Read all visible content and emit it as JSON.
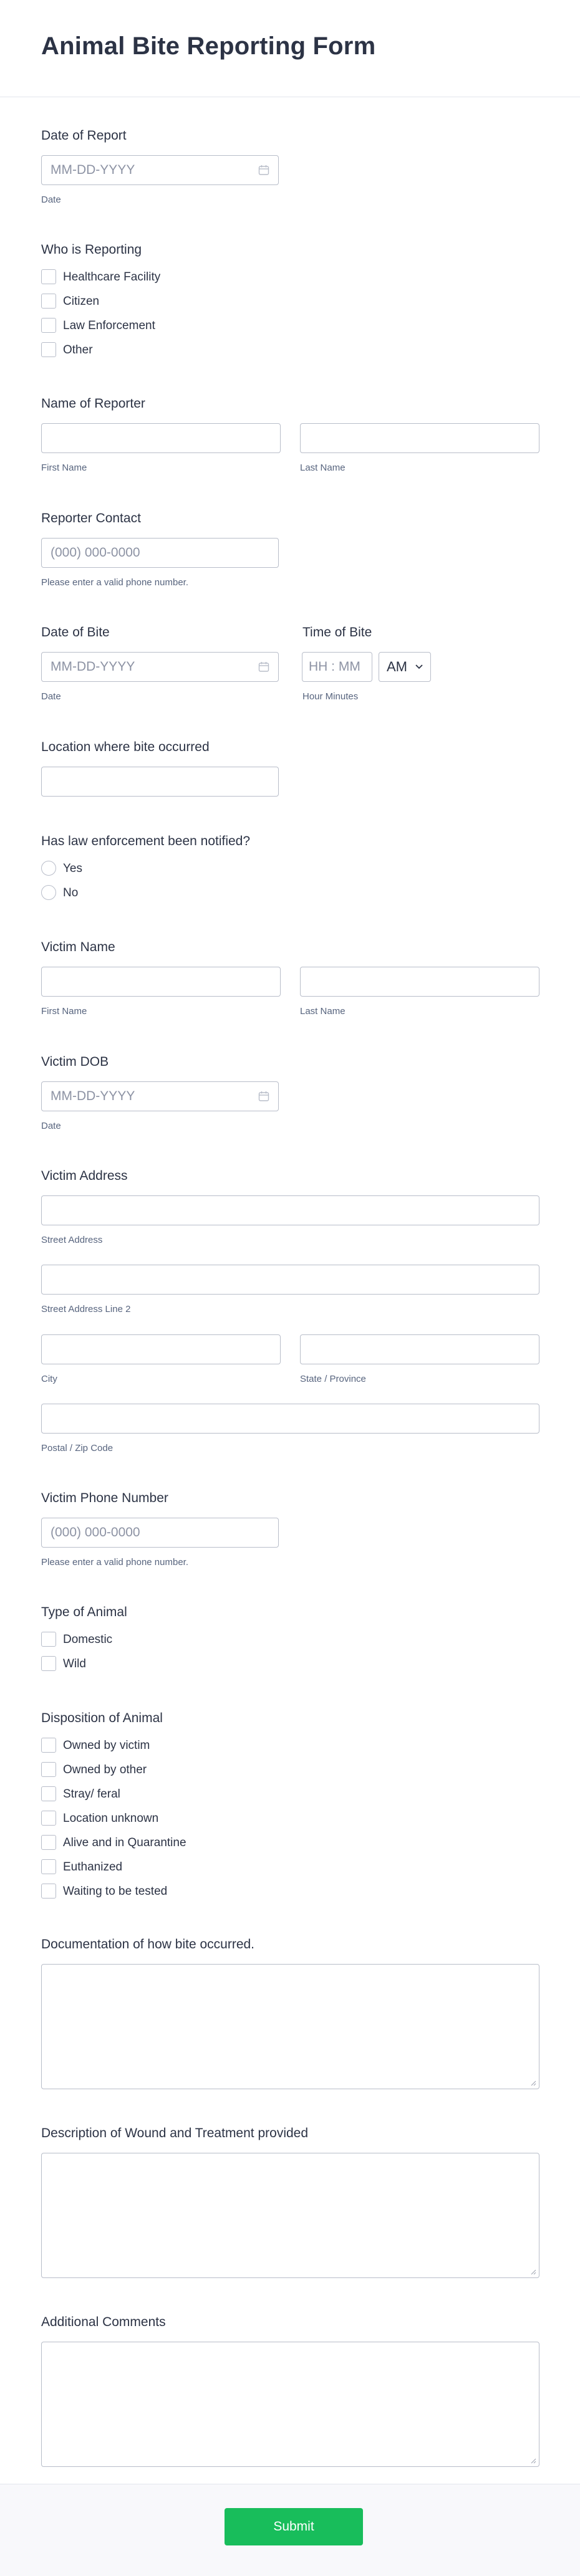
{
  "form": {
    "title": "Animal Bite Reporting Form",
    "date_of_report": {
      "label": "Date of Report",
      "placeholder": "MM-DD-YYYY",
      "sublabel": "Date"
    },
    "who_is_reporting": {
      "label": "Who is Reporting",
      "options": [
        "Healthcare Facility",
        "Citizen",
        "Law Enforcement",
        "Other"
      ]
    },
    "name_of_reporter": {
      "label": "Name of Reporter",
      "first": "First Name",
      "last": "Last Name"
    },
    "reporter_contact": {
      "label": "Reporter Contact",
      "placeholder": "(000) 000-0000",
      "sublabel": "Please enter a valid phone number."
    },
    "date_of_bite": {
      "label": "Date of Bite",
      "placeholder": "MM-DD-YYYY",
      "sublabel": "Date"
    },
    "time_of_bite": {
      "label": "Time of Bite",
      "placeholder": "HH : MM",
      "ampm": "AM",
      "sublabel": "Hour Minutes"
    },
    "location": {
      "label": "Location where bite occurred"
    },
    "law_enforcement": {
      "label": "Has law enforcement been notified?",
      "options": [
        "Yes",
        "No"
      ]
    },
    "victim_name": {
      "label": "Victim Name",
      "first": "First Name",
      "last": "Last Name"
    },
    "victim_dob": {
      "label": "Victim DOB",
      "placeholder": "MM-DD-YYYY",
      "sublabel": "Date"
    },
    "victim_address": {
      "label": "Victim Address",
      "street": "Street Address",
      "street2": "Street Address Line 2",
      "city": "City",
      "state": "State / Province",
      "zip": "Postal / Zip Code"
    },
    "victim_phone": {
      "label": "Victim Phone Number",
      "placeholder": "(000) 000-0000",
      "sublabel": "Please enter a valid phone number."
    },
    "type_of_animal": {
      "label": "Type of Animal",
      "options": [
        "Domestic",
        "Wild"
      ]
    },
    "disposition": {
      "label": "Disposition of Animal",
      "options": [
        "Owned by victim",
        "Owned by other",
        "Stray/ feral",
        "Location unknown",
        "Alive and in Quarantine",
        "Euthanized",
        "Waiting to be tested"
      ]
    },
    "documentation": {
      "label": "Documentation of how bite occurred."
    },
    "wound_description": {
      "label": "Description of Wound and Treatment provided"
    },
    "additional_comments": {
      "label": "Additional Comments"
    },
    "submit_label": "Submit"
  },
  "colors": {
    "accent": "#18bd5b",
    "border": "#b8bdc9",
    "text": "#2c3345",
    "sublabel": "#57647e"
  },
  "icons": {
    "calendar": "calendar-icon",
    "chevron": "chevron-down-icon",
    "resize": "resize-grip-icon"
  }
}
